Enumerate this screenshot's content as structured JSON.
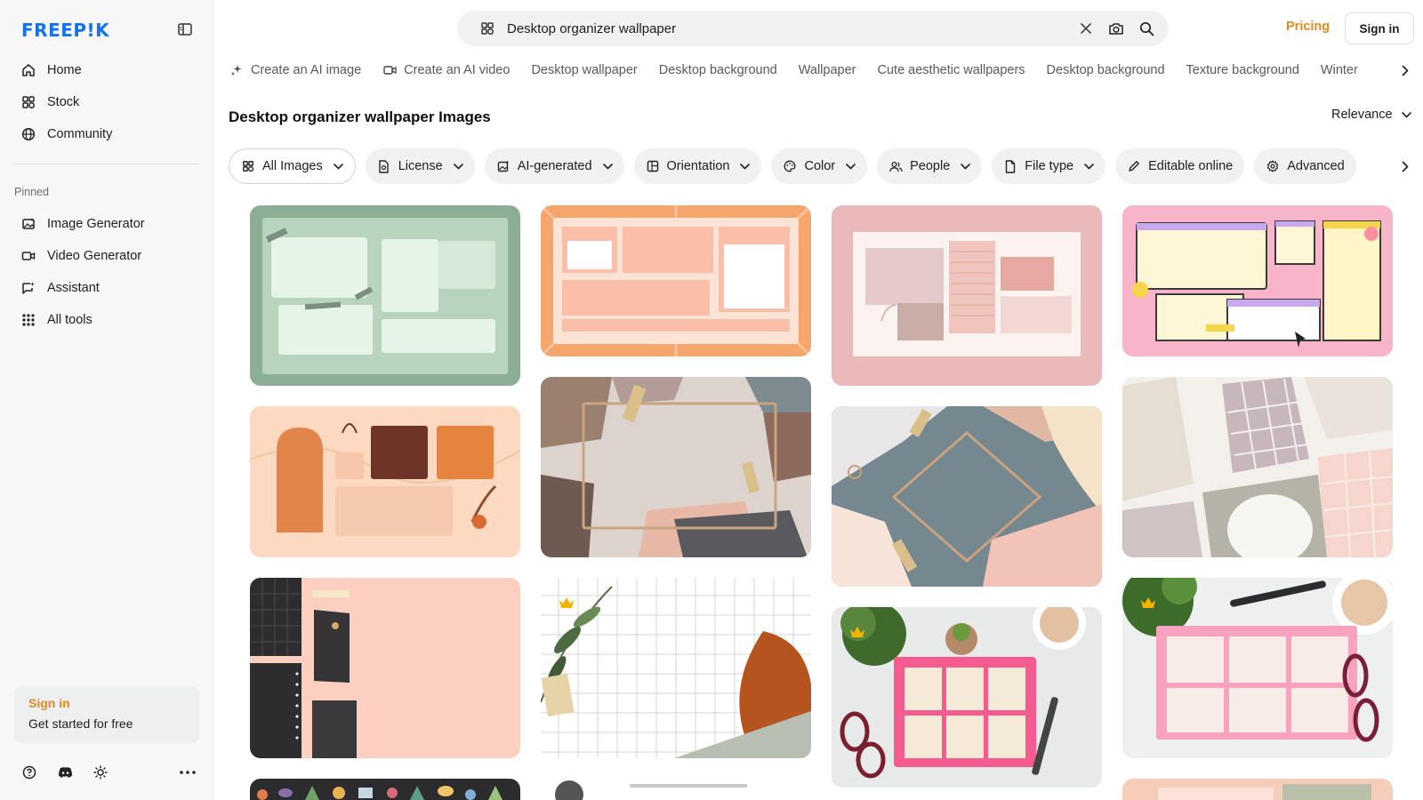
{
  "sidebar": {
    "logo": "FREEP!K",
    "nav_main": [
      {
        "label": "Home",
        "icon": "home-icon"
      },
      {
        "label": "Stock",
        "icon": "stock-icon"
      },
      {
        "label": "Community",
        "icon": "community-icon"
      }
    ],
    "pinned_label": "Pinned",
    "nav_pinned": [
      {
        "label": "Image Generator",
        "icon": "image-generator-icon"
      },
      {
        "label": "Video Generator",
        "icon": "video-generator-icon"
      },
      {
        "label": "Assistant",
        "icon": "assistant-icon"
      },
      {
        "label": "All tools",
        "icon": "grid-dots-icon"
      }
    ],
    "signin_card": {
      "title": "Sign in",
      "subtitle": "Get started for free"
    }
  },
  "header": {
    "search": {
      "value": "Desktop organizer wallpaper",
      "placeholder": "Search"
    },
    "pricing": "Pricing",
    "signin": "Sign in"
  },
  "suggestions": [
    {
      "label": "Create an AI image",
      "icon": "sparkle-icon"
    },
    {
      "label": "Create an AI video",
      "icon": "video-icon"
    },
    {
      "label": "Desktop wallpaper"
    },
    {
      "label": "Desktop background"
    },
    {
      "label": "Wallpaper"
    },
    {
      "label": "Cute aesthetic wallpapers"
    },
    {
      "label": "Desktop background"
    },
    {
      "label": "Texture background"
    },
    {
      "label": "Winter"
    }
  ],
  "results": {
    "title": "Desktop organizer wallpaper Images",
    "sort": "Relevance"
  },
  "filters": [
    {
      "label": "All Images",
      "icon": "grid-icon",
      "dropdown": true,
      "active": true
    },
    {
      "label": "License",
      "icon": "license-icon",
      "dropdown": true
    },
    {
      "label": "AI-generated",
      "icon": "ai-icon",
      "dropdown": true
    },
    {
      "label": "Orientation",
      "icon": "orientation-icon",
      "dropdown": true
    },
    {
      "label": "Color",
      "icon": "palette-icon",
      "dropdown": true
    },
    {
      "label": "People",
      "icon": "people-icon",
      "dropdown": true
    },
    {
      "label": "File type",
      "icon": "file-icon",
      "dropdown": true
    },
    {
      "label": "Editable online",
      "icon": "pen-icon",
      "dropdown": false
    },
    {
      "label": "Advanced",
      "icon": "gear-icon",
      "dropdown": false
    }
  ],
  "thumbnails": [
    {
      "style": "green-organizer",
      "premium": false
    },
    {
      "style": "orange-rays-organizer",
      "premium": false
    },
    {
      "style": "pink-notes-organizer",
      "premium": false
    },
    {
      "style": "pink-yellow-organizer",
      "premium": false
    },
    {
      "style": "boho-organizer",
      "premium": false
    },
    {
      "style": "paper-frame",
      "premium": false
    },
    {
      "style": "blue-diamond-frame",
      "premium": false
    },
    {
      "style": "beige-grid-papers",
      "premium": false
    },
    {
      "style": "peach-stationery",
      "premium": false
    },
    {
      "style": "grid-plant",
      "premium": true
    },
    {
      "style": "pink-board-desk",
      "premium": true
    },
    {
      "style": "pink-board-desk-2",
      "premium": true
    },
    {
      "style": "plants-pattern",
      "premium": false
    },
    {
      "style": "gray-partial",
      "premium": false
    },
    {
      "style": "peach-partial",
      "premium": false
    }
  ],
  "colors": {
    "accent": "#e1891d",
    "brand": "#1273eb",
    "premium": "#f5b301"
  }
}
